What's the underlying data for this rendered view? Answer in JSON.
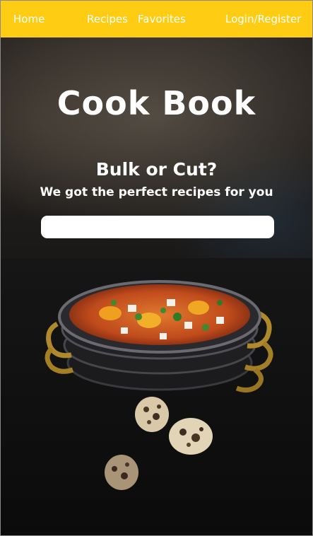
{
  "nav": {
    "home": "Home",
    "recipes": "Recipes",
    "favorites": "Favorites",
    "login": "Login/Register"
  },
  "hero": {
    "title": "Cook Book",
    "headline": "Bulk or Cut?",
    "subheadline": "We got the perfect recipes for you"
  },
  "search": {
    "value": "",
    "placeholder": ""
  },
  "colors": {
    "navbar": "#ffcc14",
    "text": "#ffffff"
  }
}
